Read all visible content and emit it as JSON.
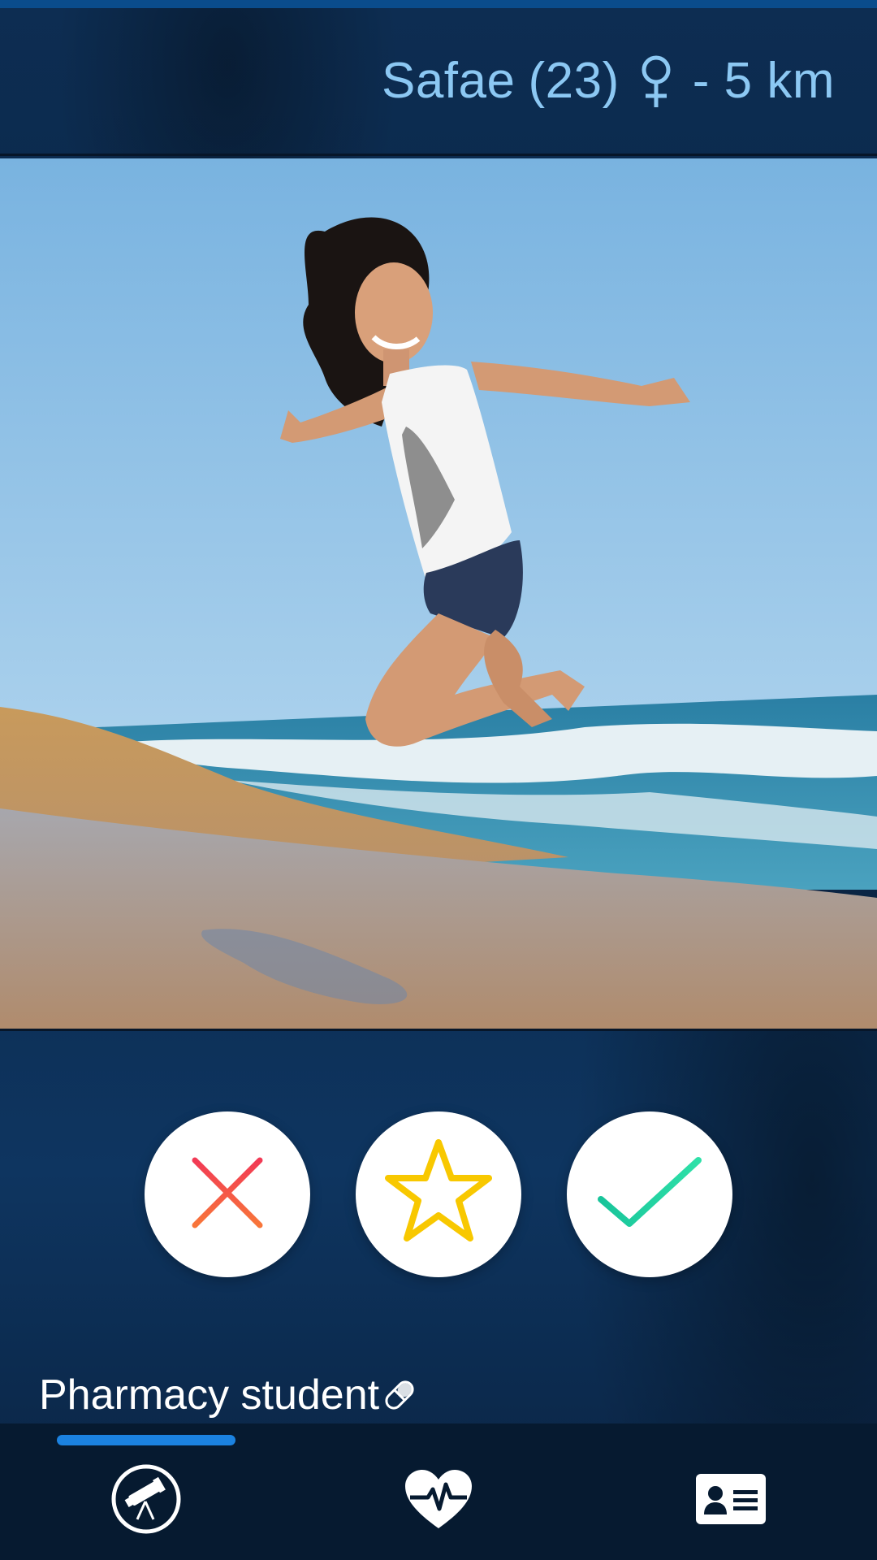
{
  "header": {
    "name": "Safae",
    "age": "(23)",
    "gender_icon": "female-symbol-icon",
    "distance": "- 5 km"
  },
  "photo": {
    "description_icon": "profile-photo"
  },
  "actions": {
    "nope_icon": "close-icon",
    "superlike_icon": "star-icon",
    "like_icon": "checkmark-icon",
    "colors": {
      "nope": "#f2544a",
      "superlike": "#f8c800",
      "like": "#1ed0a0"
    }
  },
  "bio": {
    "text": "Pharmacy student",
    "emoji": "pill-icon"
  },
  "nav": {
    "active": "discover",
    "items": [
      {
        "id": "discover",
        "icon": "telescope-icon"
      },
      {
        "id": "matches",
        "icon": "heart-pulse-icon"
      },
      {
        "id": "profile",
        "icon": "id-card-icon"
      }
    ],
    "indicator_color": "#1b82e0"
  }
}
